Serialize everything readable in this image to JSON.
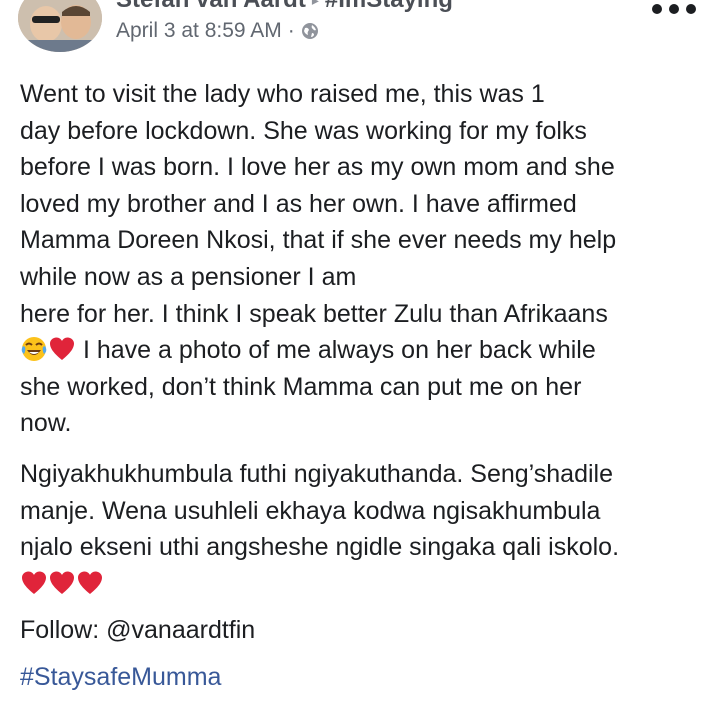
{
  "header": {
    "author_name": "Stefan van Aardt",
    "tag": "#ImStaying",
    "timestamp": "April 3 at 8:59 AM",
    "separator": "·",
    "privacy_icon": "globe-icon",
    "more_icon": "more-options-icon"
  },
  "post": {
    "para1_lines": [
      "Went to visit the lady who raised me, this was 1",
      "day before lockdown. She was working for my folks",
      "before I was born. I love her as my own mom and she",
      "loved my brother and I as her own. I have affirmed",
      "Mamma Doreen Nkosi, that if she ever needs my help",
      "while now as a pensioner I am",
      "here for her. I think I speak better Zulu than Afrikaans",
      " I have a photo of me always on her back while",
      "she worked, don’t think Mamma can put me on her",
      "now."
    ],
    "para2_lines": [
      "Ngiyakhukhumbula futhi ngiyakuthanda. Seng’shadile",
      "manje. Wena usuhleli ekhaya kodwa ngisakhumbula",
      "njalo ekseni uthi angsheshe ngidle singaka qali iskolo."
    ],
    "follow": "Follow: @vanaardtfin",
    "hashtag": "#StaysafeMumma",
    "emoji_line1": [
      "laughing-crying-emoji",
      "red-heart-emoji"
    ],
    "emoji_line2": [
      "red-heart-emoji",
      "red-heart-emoji",
      "red-heart-emoji"
    ]
  },
  "colors": {
    "text": "#1c1e21",
    "meta": "#616770",
    "link": "#385898",
    "heart": "#e0245e"
  }
}
